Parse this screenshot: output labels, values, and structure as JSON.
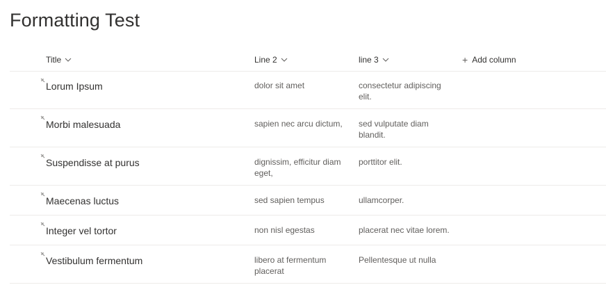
{
  "page": {
    "title": "Formatting Test"
  },
  "columns": {
    "title": "Title",
    "line2": "Line 2",
    "line3": "line 3",
    "add_column": "Add column"
  },
  "rows": [
    {
      "title": "Lorum Ipsum",
      "line2": "dolor sit amet",
      "line3": "consectetur adipiscing elit."
    },
    {
      "title": "Morbi malesuada",
      "line2": "sapien nec arcu dictum,",
      "line3": "sed vulputate diam blandit."
    },
    {
      "title": "Suspendisse at purus",
      "line2": "dignissim, efficitur diam eget,",
      "line3": "porttitor elit."
    },
    {
      "title": "Maecenas luctus",
      "line2": "sed sapien tempus",
      "line3": "ullamcorper."
    },
    {
      "title": "Integer vel tortor",
      "line2": "non nisl egestas",
      "line3": "placerat nec vitae lorem."
    },
    {
      "title": "Vestibulum fermentum",
      "line2": "libero at fermentum placerat",
      "line3": "Pellentesque ut nulla"
    }
  ],
  "icons": {
    "new_item": "new-item-icon",
    "sort": "chevron-down-icon",
    "add": "plus-icon"
  },
  "colors": {
    "text_primary": "#323130",
    "text_secondary": "#605e5c",
    "divider": "#edebe9"
  }
}
